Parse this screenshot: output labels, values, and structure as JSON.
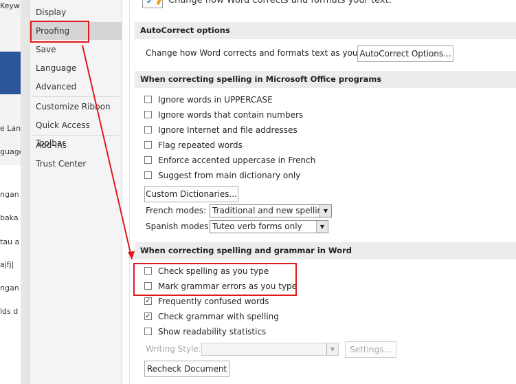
{
  "background_window": {
    "fragments": [
      "Keyw",
      "e Lan",
      "guage",
      "ngan",
      "baka",
      "tau a",
      "ajfj|",
      "ngan",
      "lds d"
    ]
  },
  "nav": {
    "items": [
      {
        "label": "Display"
      },
      {
        "label": "Proofing"
      },
      {
        "label": "Save"
      },
      {
        "label": "Language"
      },
      {
        "label": "Advanced"
      },
      {
        "label": "Customize Ribbon"
      },
      {
        "label": "Quick Access Toolbar"
      },
      {
        "label": "Add-Ins"
      },
      {
        "label": "Trust Center"
      }
    ],
    "selected": "Proofing"
  },
  "header_text": "Change how Word corrects and formats your text.",
  "autocorrect": {
    "heading": "AutoCorrect options",
    "description": "Change how Word corrects and formats text as you type:",
    "button": "AutoCorrect Options..."
  },
  "office_spelling": {
    "heading": "When correcting spelling in Microsoft Office programs",
    "options": [
      {
        "label": "Ignore words in UPPERCASE",
        "checked": false
      },
      {
        "label": "Ignore words that contain numbers",
        "checked": false
      },
      {
        "label": "Ignore Internet and file addresses",
        "checked": false
      },
      {
        "label": "Flag repeated words",
        "checked": false
      },
      {
        "label": "Enforce accented uppercase in French",
        "checked": false
      },
      {
        "label": "Suggest from main dictionary only",
        "checked": false
      }
    ],
    "custom_dict_button": "Custom Dictionaries...",
    "french_modes_label": "French modes:",
    "french_modes_value": "Traditional and new spellings",
    "spanish_modes_label": "Spanish modes:",
    "spanish_modes_value": "Tuteo verb forms only"
  },
  "word_spelling": {
    "heading": "When correcting spelling and grammar in Word",
    "options": [
      {
        "label": "Check spelling as you type",
        "checked": false
      },
      {
        "label": "Mark grammar errors as you type",
        "checked": false
      },
      {
        "label": "Frequently confused words",
        "checked": true
      },
      {
        "label": "Check grammar with spelling",
        "checked": true
      },
      {
        "label": "Show readability statistics",
        "checked": false
      }
    ],
    "writing_style_label": "Writing Style:",
    "writing_style_value": "",
    "settings_button": "Settings...",
    "recheck_button": "Recheck Document"
  },
  "annotation_color": "#e0191c",
  "checkmark_glyph": "✓"
}
